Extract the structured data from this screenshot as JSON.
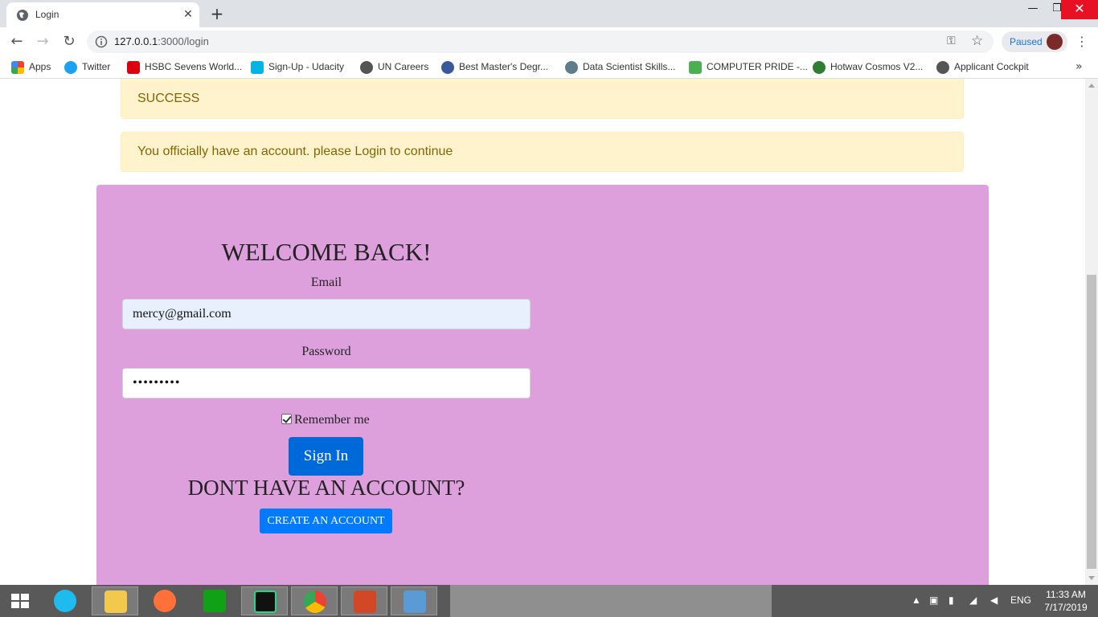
{
  "browser": {
    "tab_title": "Login",
    "url_host": "127.0.0.1",
    "url_rest": ":3000/login",
    "profile_status": "Paused",
    "bookmarks": [
      {
        "label": "Apps",
        "color": "#ea4335"
      },
      {
        "label": "Twitter",
        "color": "#1da1f2"
      },
      {
        "label": "HSBC Sevens World...",
        "color": "#db0011"
      },
      {
        "label": "Sign-Up - Udacity",
        "color": "#02b3e4"
      },
      {
        "label": "UN Careers",
        "color": "#555555"
      },
      {
        "label": "Best Master's Degr...",
        "color": "#3b5998"
      },
      {
        "label": "Data Scientist Skills...",
        "color": "#607d8b"
      },
      {
        "label": "COMPUTER PRIDE -...",
        "color": "#4caf50"
      },
      {
        "label": "Hotwav Cosmos V2...",
        "color": "#2e7d32"
      },
      {
        "label": "Applicant Cockpit",
        "color": "#555555"
      }
    ]
  },
  "alerts": {
    "success": "SUCCESS",
    "account_created": "You officially have an account. please Login to continue"
  },
  "login": {
    "heading": "WELCOME BACK!",
    "email_label": "Email",
    "email_value": "mercy@gmail.com",
    "password_label": "Password",
    "password_mask": "•••••••••",
    "remember_label": "Remember me",
    "remember_checked": true,
    "signin_label": "Sign In",
    "no_account_heading": "DONT HAVE AN ACCOUNT?",
    "create_label": "CREATE AN ACCOUNT"
  },
  "colors": {
    "card_bg": "#dda0dd",
    "alert_bg": "#fff3cd",
    "alert_text": "#856404",
    "primary_button": "#0069d9",
    "create_button": "#007bff"
  },
  "taskbar": {
    "language": "ENG",
    "time": "11:33 AM",
    "date": "7/17/2019"
  }
}
